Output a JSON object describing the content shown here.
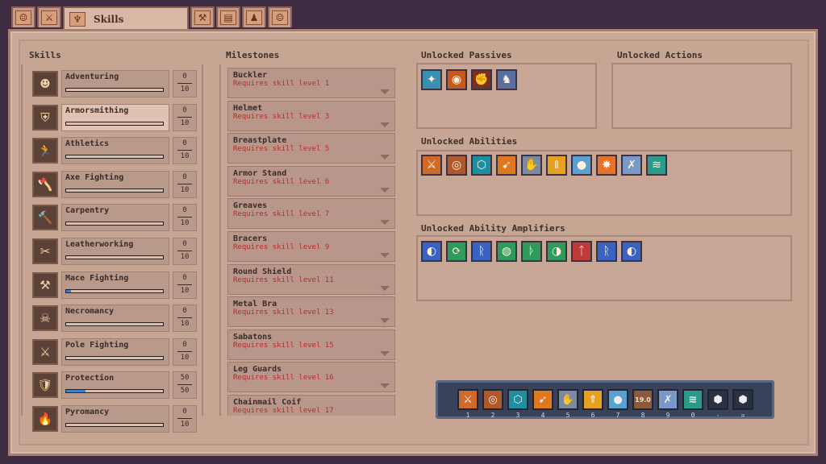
{
  "tabs": {
    "active_label": "Skills",
    "icons": [
      "map-icon",
      "sword-icon",
      "skill-tree-icon",
      "crossed-tools-icon",
      "book-icon",
      "character-icon",
      "scroll-icon"
    ]
  },
  "headers": {
    "skills": "Skills",
    "milestones": "Milestones",
    "unlocked_passives": "Unlocked Passives",
    "unlocked_actions": "Unlocked Actions",
    "unlocked_abilities": "Unlocked Abilities",
    "unlocked_amplifiers": "Unlocked Ability Amplifiers"
  },
  "skills": [
    {
      "name": "Adventuring",
      "level": "0",
      "max": "10",
      "progress": 0,
      "icon": "☻"
    },
    {
      "name": "Armorsmithing",
      "level": "0",
      "max": "10",
      "progress": 0,
      "icon": "⛨",
      "selected": true
    },
    {
      "name": "Athletics",
      "level": "0",
      "max": "10",
      "progress": 0,
      "icon": "🏃"
    },
    {
      "name": "Axe Fighting",
      "level": "0",
      "max": "10",
      "progress": 0,
      "icon": "🪓"
    },
    {
      "name": "Carpentry",
      "level": "0",
      "max": "10",
      "progress": 0,
      "icon": "🔨"
    },
    {
      "name": "Leatherworking",
      "level": "0",
      "max": "10",
      "progress": 0,
      "icon": "✂"
    },
    {
      "name": "Mace Fighting",
      "level": "0",
      "max": "10",
      "progress": 0.05,
      "icon": "⚒"
    },
    {
      "name": "Necromancy",
      "level": "0",
      "max": "10",
      "progress": 0,
      "icon": "☠"
    },
    {
      "name": "Pole Fighting",
      "level": "0",
      "max": "10",
      "progress": 0,
      "icon": "⚔"
    },
    {
      "name": "Protection",
      "level": "50",
      "max": "50",
      "progress": 0.2,
      "icon": "🛡"
    },
    {
      "name": "Pyromancy",
      "level": "0",
      "max": "10",
      "progress": 0,
      "icon": "🔥"
    }
  ],
  "milestones": [
    {
      "title": "Buckler",
      "req": "Requires skill level 1"
    },
    {
      "title": "Helmet",
      "req": "Requires skill level 3"
    },
    {
      "title": "Breastplate",
      "req": "Requires skill level 5"
    },
    {
      "title": "Armor Stand",
      "req": "Requires skill level 6"
    },
    {
      "title": "Greaves",
      "req": "Requires skill level 7"
    },
    {
      "title": "Bracers",
      "req": "Requires skill level 9"
    },
    {
      "title": "Round Shield",
      "req": "Requires skill level 11"
    },
    {
      "title": "Metal Bra",
      "req": "Requires skill level 13"
    },
    {
      "title": "Sabatons",
      "req": "Requires skill level 15"
    },
    {
      "title": "Leg Guards",
      "req": "Requires skill level 16"
    },
    {
      "title": "Chainmail Coif",
      "req": "Requires skill level 17"
    }
  ],
  "passives": [
    {
      "icon": "aura-icon",
      "glyph": "✦",
      "color": "#3b8fb0"
    },
    {
      "icon": "shield-ring-icon",
      "glyph": "◉",
      "color": "#c45a1e"
    },
    {
      "icon": "fire-fist-icon",
      "glyph": "✊",
      "color": "#7a3020"
    },
    {
      "icon": "knight-icon",
      "glyph": "♞",
      "color": "#5a6fa0"
    }
  ],
  "abilities": [
    {
      "icon": "sword-strike-icon",
      "glyph": "⚔",
      "color": "#d06a2a"
    },
    {
      "icon": "shield-bash-icon",
      "glyph": "◎",
      "color": "#b0582a"
    },
    {
      "icon": "barrier-icon",
      "glyph": "⬡",
      "color": "#1f8fa0"
    },
    {
      "icon": "charge-icon",
      "glyph": "➹",
      "color": "#e07820"
    },
    {
      "icon": "fortify-icon",
      "glyph": "✋",
      "color": "#7a8aa0"
    },
    {
      "icon": "rally-icon",
      "glyph": "⇑",
      "color": "#e8a020"
    },
    {
      "icon": "orb-icon",
      "glyph": "●",
      "color": "#5aa0d0"
    },
    {
      "icon": "explosion-icon",
      "glyph": "✸",
      "color": "#e8722a"
    },
    {
      "icon": "parry-icon",
      "glyph": "✗",
      "color": "#7a98c8"
    },
    {
      "icon": "whirlwind-icon",
      "glyph": "≋",
      "color": "#2a9a8a"
    }
  ],
  "amplifiers": [
    {
      "icon": "rune-blue-icon",
      "glyph": "◐",
      "color": "#3a62c0"
    },
    {
      "icon": "rune-green-icon",
      "glyph": "⟳",
      "color": "#2f9a5a"
    },
    {
      "icon": "rune-blue-icon-2",
      "glyph": "ᚱ",
      "color": "#3a62c0"
    },
    {
      "icon": "rune-green-icon-2",
      "glyph": "◍",
      "color": "#2f9a5a"
    },
    {
      "icon": "rune-green-icon-3",
      "glyph": "ᚦ",
      "color": "#2f9a5a"
    },
    {
      "icon": "rune-green-icon-4",
      "glyph": "◑",
      "color": "#2f9a5a"
    },
    {
      "icon": "rune-red-icon",
      "glyph": "ᛏ",
      "color": "#c03a3a"
    },
    {
      "icon": "rune-blue-icon-3",
      "glyph": "ᚱ",
      "color": "#3a62c0"
    },
    {
      "icon": "rune-blue-icon-4",
      "glyph": "◐",
      "color": "#3a62c0"
    }
  ],
  "hotbar": {
    "slots": [
      {
        "key": "1",
        "glyph": "⚔",
        "color": "#d06a2a"
      },
      {
        "key": "2",
        "glyph": "◎",
        "color": "#b0582a"
      },
      {
        "key": "3",
        "glyph": "⬡",
        "color": "#1f8fa0"
      },
      {
        "key": "4",
        "glyph": "➹",
        "color": "#e07820"
      },
      {
        "key": "5",
        "glyph": "✋",
        "color": "#7a8aa0"
      },
      {
        "key": "6",
        "glyph": "⇑",
        "color": "#e8a020"
      },
      {
        "key": "7",
        "glyph": "●",
        "color": "#5aa0d0"
      },
      {
        "key": "8",
        "glyph": "19.0",
        "color": "#8a5a3a"
      },
      {
        "key": "9",
        "glyph": "✗",
        "color": "#7a98c8"
      },
      {
        "key": "0",
        "glyph": "≋",
        "color": "#2a9a8a"
      },
      {
        "key": "-",
        "glyph": "⬢",
        "color": "#2a3242"
      },
      {
        "key": "=",
        "glyph": "⬢",
        "color": "#2a3242"
      }
    ]
  }
}
